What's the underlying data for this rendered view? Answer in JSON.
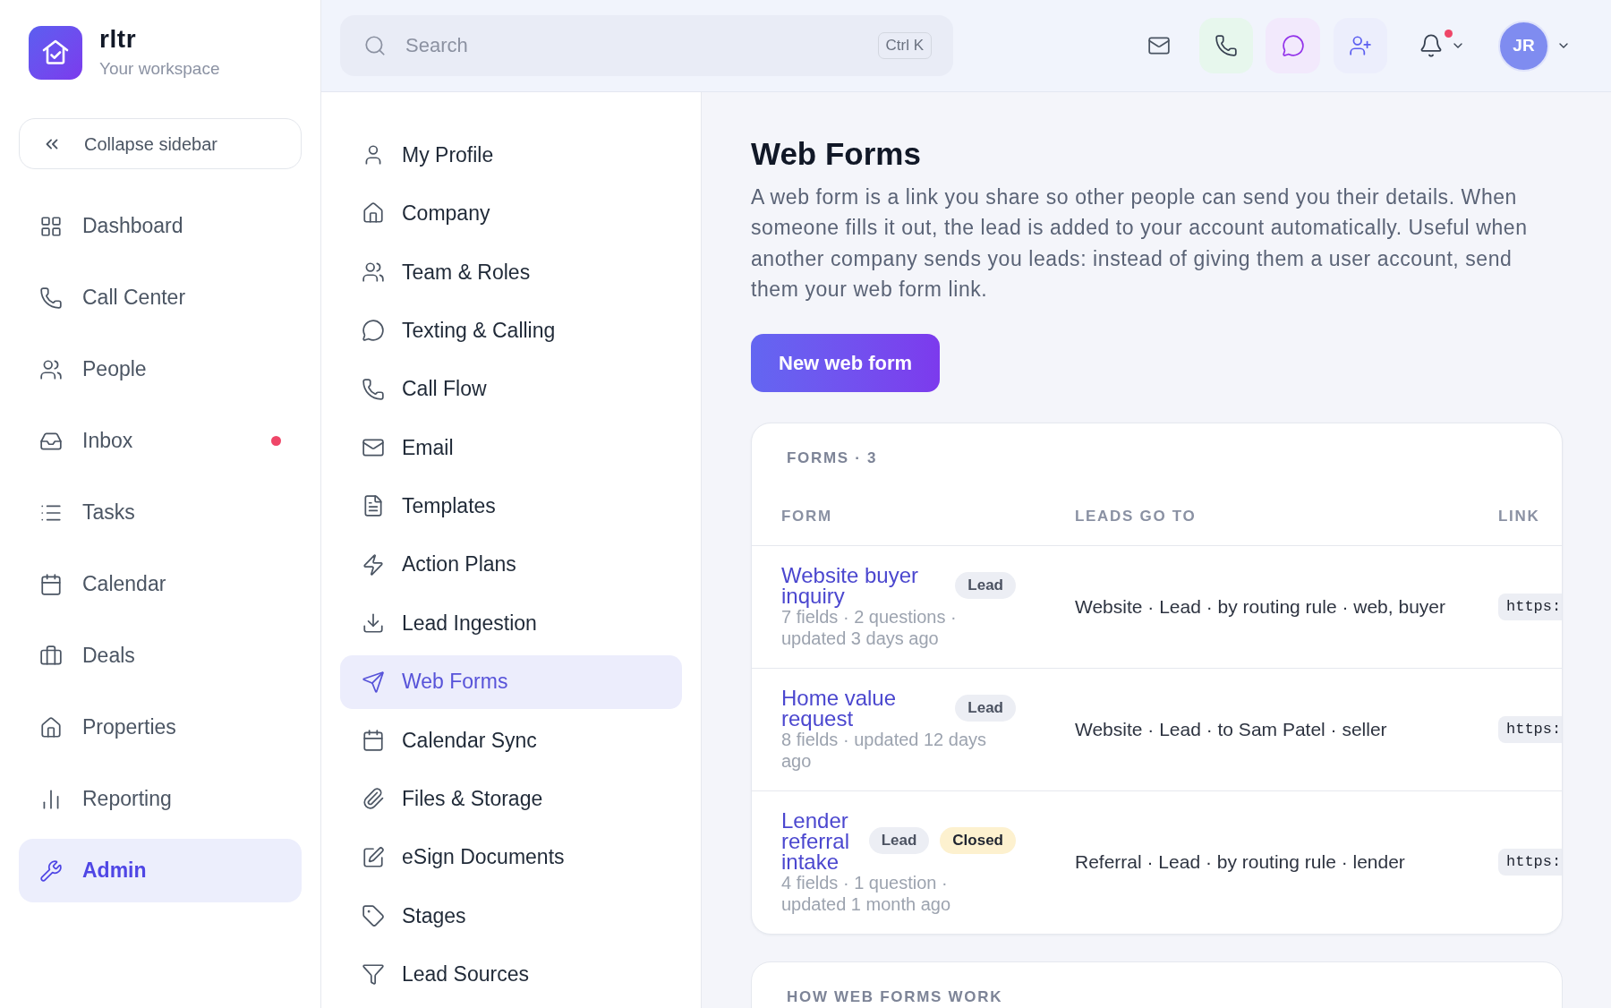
{
  "workspace": {
    "name": "rltr",
    "subtitle": "Your workspace"
  },
  "collapse_button": {
    "label": "Collapse sidebar"
  },
  "sidebar": {
    "items": [
      {
        "label": "Dashboard",
        "selected": false,
        "unread": false
      },
      {
        "label": "Call Center",
        "selected": false,
        "unread": false
      },
      {
        "label": "People",
        "selected": false,
        "unread": false
      },
      {
        "label": "Inbox",
        "selected": false,
        "unread": true
      },
      {
        "label": "Tasks",
        "selected": false,
        "unread": false
      },
      {
        "label": "Calendar",
        "selected": false,
        "unread": false
      },
      {
        "label": "Deals",
        "selected": false,
        "unread": false
      },
      {
        "label": "Properties",
        "selected": false,
        "unread": false
      },
      {
        "label": "Reporting",
        "selected": false,
        "unread": false
      },
      {
        "label": "Admin",
        "selected": true,
        "unread": false
      }
    ]
  },
  "topbar": {
    "search": {
      "placeholder": "Search",
      "shortcut": "Ctrl K"
    },
    "notifications": {
      "unread": true
    },
    "avatar": {
      "initials": "JR"
    }
  },
  "settings_menu": {
    "items": [
      {
        "label": "My Profile",
        "selected": false
      },
      {
        "label": "Company",
        "selected": false
      },
      {
        "label": "Team & Roles",
        "selected": false
      },
      {
        "label": "Texting & Calling",
        "selected": false
      },
      {
        "label": "Call Flow",
        "selected": false
      },
      {
        "label": "Email",
        "selected": false
      },
      {
        "label": "Templates",
        "selected": false
      },
      {
        "label": "Action Plans",
        "selected": false
      },
      {
        "label": "Lead Ingestion",
        "selected": false
      },
      {
        "label": "Web Forms",
        "selected": true
      },
      {
        "label": "Calendar Sync",
        "selected": false
      },
      {
        "label": "Files & Storage",
        "selected": false
      },
      {
        "label": "eSign Documents",
        "selected": false
      },
      {
        "label": "Stages",
        "selected": false
      },
      {
        "label": "Lead Sources",
        "selected": false
      }
    ]
  },
  "page": {
    "title": "Web Forms",
    "description": "A web form is a link you share so other people can send you their details. When someone fills it out, the lead is added to your account automatically. Useful when another company sends you leads: instead of giving them a user account, send them your web form link.",
    "new_button": "New web form"
  },
  "forms_card": {
    "heading": "FORMS · 3",
    "columns": [
      "FORM",
      "LEADS GO TO",
      "LINK"
    ],
    "rows": [
      {
        "title": "Website buyer inquiry",
        "badges": [
          {
            "label": "Lead",
            "kind": "neutral"
          }
        ],
        "meta": "7 fields · 2 questions · updated 3 days ago",
        "leads_go_to": "Website · Lead · by routing rule · web, buyer",
        "link": "https:"
      },
      {
        "title": "Home value request",
        "badges": [
          {
            "label": "Lead",
            "kind": "neutral"
          }
        ],
        "meta": "8 fields · updated 12 days ago",
        "leads_go_to": "Website · Lead · to Sam Patel · seller",
        "link": "https:"
      },
      {
        "title": "Lender referral intake",
        "badges": [
          {
            "label": "Lead",
            "kind": "neutral"
          },
          {
            "label": "Closed",
            "kind": "warning"
          }
        ],
        "meta": "4 fields · 1 question · updated 1 month ago",
        "leads_go_to": "Referral · Lead · by routing rule · lender",
        "link": "https:"
      }
    ]
  },
  "how_card": {
    "heading": "HOW WEB FORMS WORK"
  }
}
